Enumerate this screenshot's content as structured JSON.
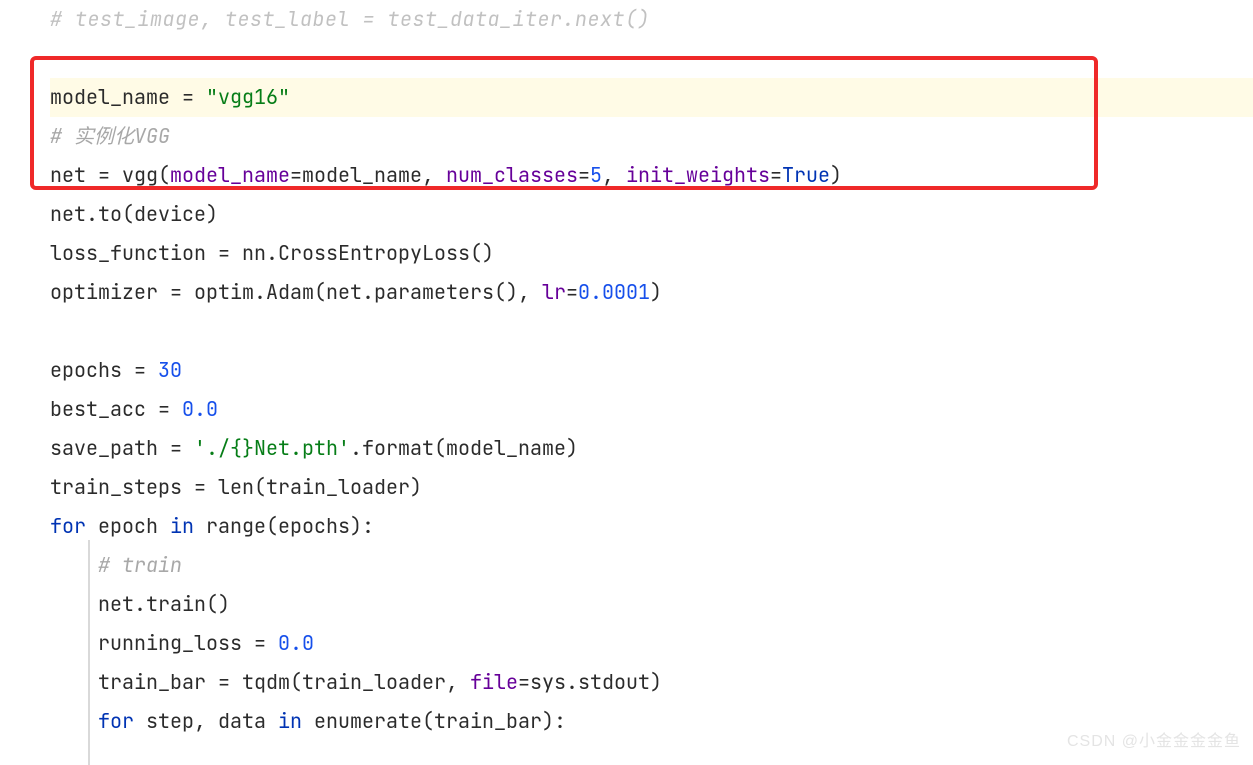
{
  "lines": {
    "top_comment": "# test_image, test_label = test_data_iter.next()",
    "l1_a": "model_name = ",
    "l1_str": "\"vgg16\"",
    "l2_comment": "# 实例化VGG",
    "l3_a": "net = vgg(",
    "l3_p1": "model_name",
    "l3_eq1": "=model_name, ",
    "l3_p2": "num_classes",
    "l3_eq2": "=",
    "l3_n1": "5",
    "l3_c2": ", ",
    "l3_p3": "init_weights",
    "l3_eq3": "=",
    "l3_bool": "True",
    "l3_close": ")",
    "l4": "net.to(device)",
    "l5": "loss_function = nn.CrossEntropyLoss()",
    "l6_a": "optimizer = optim.Adam(net.parameters(), ",
    "l6_p": "lr",
    "l6_eq": "=",
    "l6_n": "0.0001",
    "l6_close": ")",
    "l7_a": "epochs = ",
    "l7_n": "30",
    "l8_a": "best_acc = ",
    "l8_n": "0.0",
    "l9_a": "save_path = ",
    "l9_str": "'./{}Net.pth'",
    "l9_b": ".format(model_name)",
    "l10": "train_steps = len(train_loader)",
    "l11_kw1": "for",
    "l11_a": " epoch ",
    "l11_kw2": "in",
    "l11_b": " range(epochs):",
    "l12_comment": "    # train",
    "l13": "    net.train()",
    "l14_a": "    running_loss = ",
    "l14_n": "0.0",
    "l15_a": "    train_bar = tqdm(train_loader, ",
    "l15_p": "file",
    "l15_b": "=sys.stdout)",
    "l16_pad": "    ",
    "l16_kw1": "for",
    "l16_a": " step, data ",
    "l16_kw2": "in",
    "l16_b": " enumerate(train_bar):"
  },
  "watermark": "CSDN @小金金金金鱼"
}
